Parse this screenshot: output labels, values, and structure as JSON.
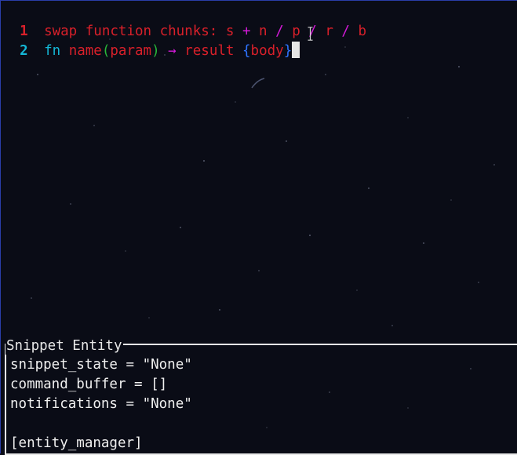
{
  "editor": {
    "lines": [
      {
        "number": "1",
        "segments": {
          "a": "swap function chunks:",
          "b": " s ",
          "c": "+",
          "d": " n ",
          "e": "/",
          "f": " p ",
          "g": "/",
          "h": " r ",
          "i": "/",
          "j": " b"
        }
      },
      {
        "number": "2",
        "segments": {
          "kw": "fn",
          "name": " name",
          "po": "(",
          "param": "param",
          "pc": ")",
          "arrow": " → ",
          "result": "result ",
          "bo": "{",
          "body": "body",
          "bc": "}"
        }
      }
    ]
  },
  "panel": {
    "title": "Snippet Entity",
    "rows": [
      "snippet_state = \"None\"",
      "command_buffer = []",
      "notifications = \"None\"",
      "",
      "[entity_manager]"
    ]
  },
  "colors": {
    "line_number_1": "#d8202a",
    "line_number_2": "#14b7d6",
    "keyword": "#14b7d6",
    "identifier": "#d8202a",
    "operator": "#d41ad8",
    "paren": "#28b83a",
    "brace": "#2f74ff",
    "panel_text": "#f0f0f0"
  },
  "icons": {
    "cursor": "block-cursor-icon",
    "mouse": "text-ibeam-icon"
  }
}
